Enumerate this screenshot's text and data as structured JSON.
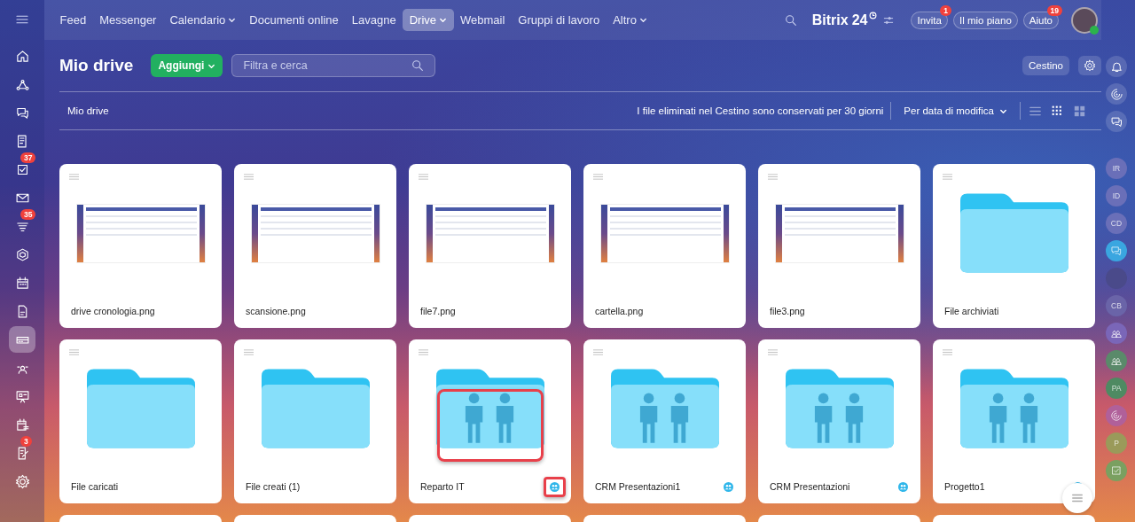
{
  "top_nav": {
    "tabs": [
      {
        "label": "Feed",
        "selected": false,
        "has_caret": false
      },
      {
        "label": "Messenger",
        "selected": false,
        "has_caret": false
      },
      {
        "label": "Calendario",
        "selected": false,
        "has_caret": true
      },
      {
        "label": "Documenti online",
        "selected": false,
        "has_caret": false
      },
      {
        "label": "Lavagne",
        "selected": false,
        "has_caret": false
      },
      {
        "label": "Drive",
        "selected": true,
        "has_caret": true
      },
      {
        "label": "Webmail",
        "selected": false,
        "has_caret": false
      },
      {
        "label": "Gruppi di lavoro",
        "selected": false,
        "has_caret": false
      },
      {
        "label": "Altro",
        "selected": false,
        "has_caret": true
      }
    ],
    "logo": "Bitrix",
    "logo_number": "24",
    "buttons": [
      {
        "label": "Invita",
        "badge": "1"
      },
      {
        "label": "Il mio piano"
      },
      {
        "label": "Aiuto",
        "badge": "19"
      }
    ]
  },
  "left_sidebar": {
    "items": [
      {
        "kind": "home",
        "selected": false
      },
      {
        "kind": "share",
        "selected": false
      },
      {
        "kind": "chat",
        "selected": false
      },
      {
        "kind": "feed",
        "selected": false
      },
      {
        "kind": "tasks",
        "selected": false,
        "badge": "37"
      },
      {
        "kind": "mail",
        "selected": false
      },
      {
        "kind": "funnel",
        "selected": false,
        "badge": "35"
      },
      {
        "kind": "hexagon",
        "selected": false
      },
      {
        "kind": "calendar",
        "selected": false
      },
      {
        "kind": "document",
        "selected": false
      },
      {
        "kind": "drive",
        "selected": true
      },
      {
        "kind": "people",
        "selected": false
      },
      {
        "kind": "board",
        "selected": false
      },
      {
        "kind": "schedule",
        "selected": false
      },
      {
        "kind": "sign",
        "selected": false,
        "badge": "3"
      },
      {
        "kind": "settings",
        "selected": false
      }
    ]
  },
  "header": {
    "title": "Mio drive",
    "add_button": "Aggiungi",
    "search": {
      "placeholder": "Filtra e cerca"
    },
    "trash_button": "Cestino"
  },
  "toolbar": {
    "breadcrumb": "Mio drive",
    "notice": "I file eliminati nel Cestino sono conservati per 30 giorni",
    "sort": "Per data di modifica",
    "views": [
      {
        "kind": "list",
        "selected": false
      },
      {
        "kind": "small-grid",
        "selected": true
      },
      {
        "kind": "large-grid",
        "selected": false
      }
    ]
  },
  "files": [
    {
      "name": "drive cronologia.png",
      "kind": "image"
    },
    {
      "name": "scansione.png",
      "kind": "image"
    },
    {
      "name": "file7.png",
      "kind": "image"
    },
    {
      "name": "cartella.png",
      "kind": "image"
    },
    {
      "name": "file3.png",
      "kind": "image"
    },
    {
      "name": "File archiviati",
      "kind": "folder",
      "highlighted": false
    },
    {
      "name": "File caricati",
      "kind": "folder",
      "highlighted": false
    },
    {
      "name": "File creati (1)",
      "kind": "folder",
      "highlighted": false
    },
    {
      "name": "Reparto IT",
      "kind": "shared-folder",
      "highlighted": true
    },
    {
      "name": "CRM Presentazioni1",
      "kind": "shared-folder",
      "highlighted": false
    },
    {
      "name": "CRM Presentazioni",
      "kind": "shared-folder",
      "highlighted": false
    },
    {
      "name": "Progetto1",
      "kind": "shared-folder",
      "highlighted": false
    }
  ],
  "right_sidebar": {
    "items": [
      {
        "kind": "bell"
      },
      {
        "kind": "spiral"
      },
      {
        "kind": "chat"
      },
      {
        "kind": "initials",
        "text": "IR",
        "color": "#6a6fb8"
      },
      {
        "kind": "initials",
        "text": "ID",
        "color": "#6a6fb8"
      },
      {
        "kind": "initials",
        "text": "CD",
        "color": "#6a6fb8"
      },
      {
        "kind": "chat-avatar",
        "color": "#3aa6e0"
      },
      {
        "kind": "photo",
        "color": "#4a4a8a"
      },
      {
        "kind": "initials",
        "text": "CB",
        "color": "#6a64a8"
      },
      {
        "kind": "group",
        "color": "#7a66b8"
      },
      {
        "kind": "group",
        "color": "#5a8a6a"
      },
      {
        "kind": "initials",
        "text": "PA",
        "color": "#4e8a62"
      },
      {
        "kind": "spiral-avatar",
        "color": "#b0609a"
      },
      {
        "kind": "initials",
        "text": "P",
        "color": "#9a9a5a"
      },
      {
        "kind": "task-avatar",
        "color": "#7aa060"
      }
    ]
  }
}
